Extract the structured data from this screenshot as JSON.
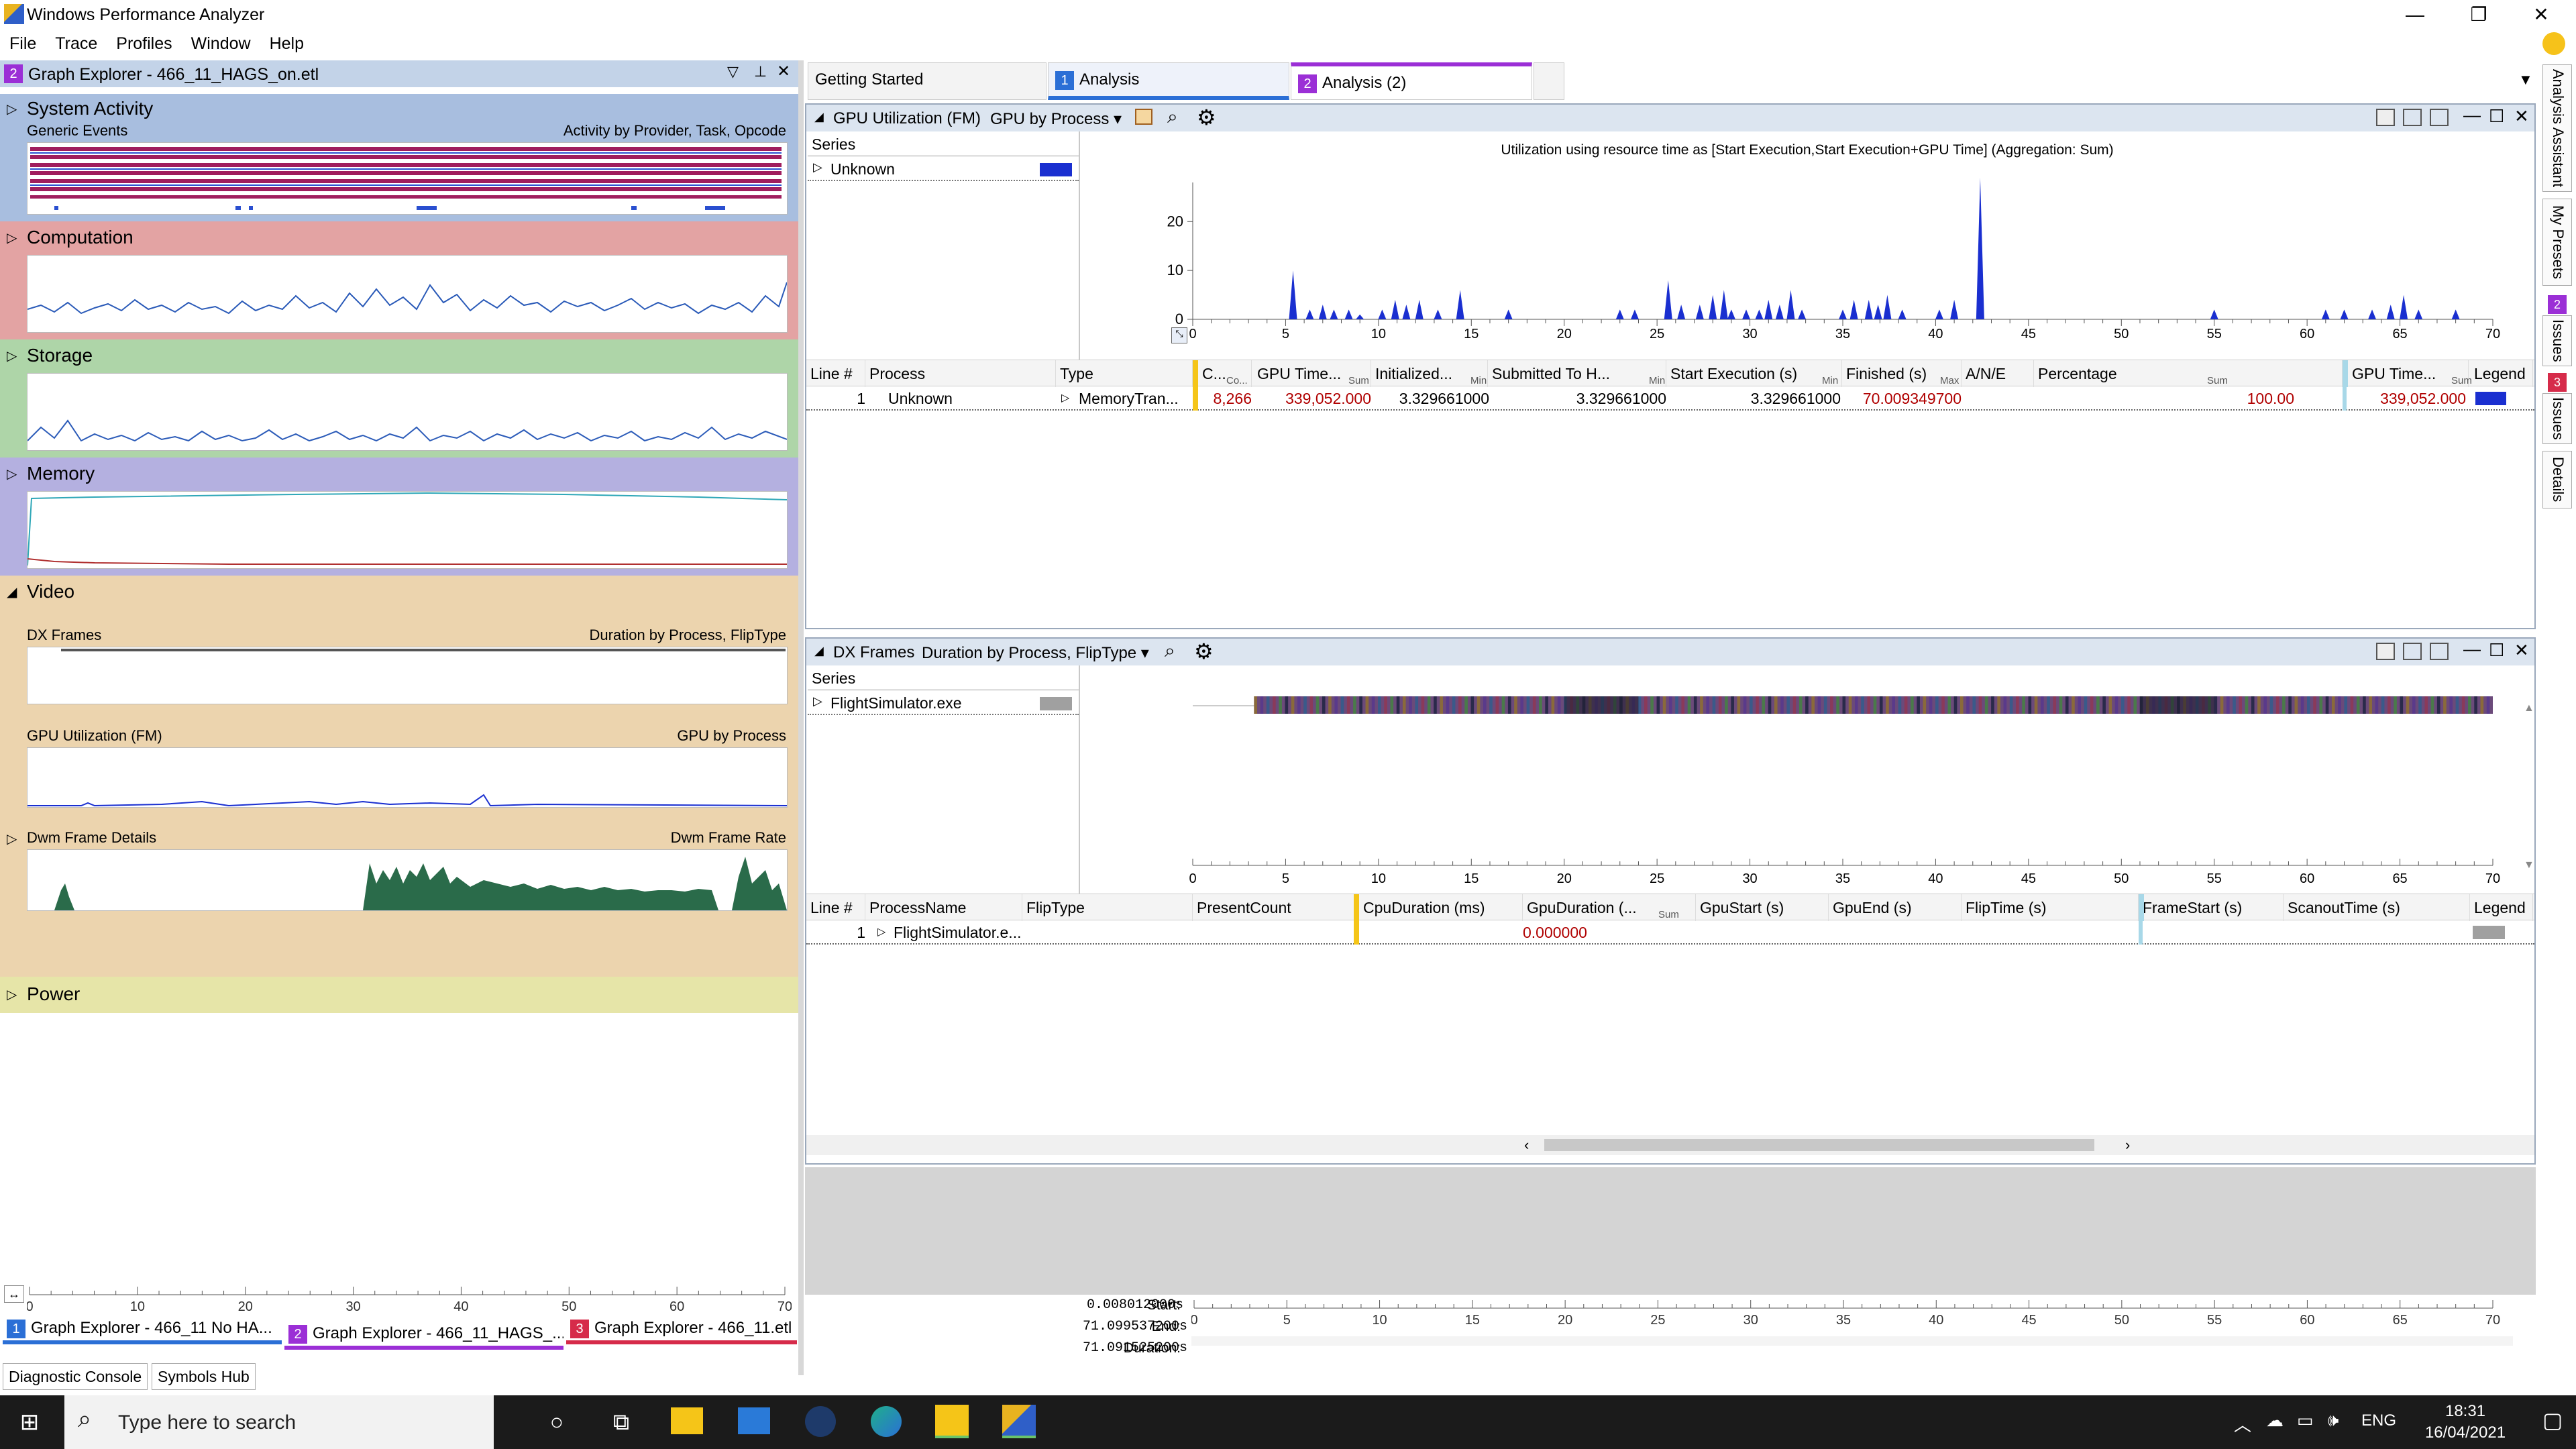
{
  "app": {
    "title": "Windows Performance Analyzer"
  },
  "window_controls": {
    "minimize": "—",
    "restore": "❐",
    "close": "✕"
  },
  "menu": [
    "File",
    "Trace",
    "Profiles",
    "Window",
    "Help"
  ],
  "graph_explorer": {
    "tab_num": "2",
    "title": "Graph Explorer - 466_11_HAGS_on.etl",
    "groups": [
      {
        "name": "System Activity",
        "sub": "Generic Events",
        "right": "Activity by Provider, Task, Opcode",
        "color": "#a8bedf"
      },
      {
        "name": "Computation",
        "color": "#e3a3a3"
      },
      {
        "name": "Storage",
        "color": "#aed5a8"
      },
      {
        "name": "Memory",
        "color": "#b4b0e0"
      },
      {
        "name": "Video",
        "color": "#ecd4ae"
      },
      {
        "name": "Power",
        "color": "#e6e5a8"
      }
    ],
    "video": {
      "dx_frames": "DX Frames",
      "dx_right": "Duration by Process, FlipType",
      "gpu_util": "GPU Utilization (FM)",
      "gpu_right": "GPU by Process",
      "dwm": "Dwm Frame Details",
      "dwm_right": "Dwm Frame Rate"
    },
    "axis_ticks": [
      "0",
      "10",
      "20",
      "30",
      "40",
      "50",
      "60",
      "70"
    ]
  },
  "doc_tabs": [
    {
      "label": "Getting Started",
      "num": "",
      "color": ""
    },
    {
      "label": "Analysis",
      "num": "1",
      "color": "#2b6fd6"
    },
    {
      "label": "Analysis (2)",
      "num": "2",
      "color": "#9b2fd6"
    }
  ],
  "gpu_panel": {
    "title": "GPU Utilization (FM)",
    "preset": "GPU by Process",
    "series_header": "Series",
    "series": [
      {
        "name": "Unknown",
        "color": "#1a2fd0"
      }
    ],
    "chart_title": "Utilization using resource time as [Start Execution,Start Execution+GPU Time] (Aggregation: Sum)",
    "y_ticks": [
      "0",
      "10",
      "20"
    ],
    "x_ticks": [
      "0",
      "5",
      "10",
      "15",
      "20",
      "25",
      "30",
      "35",
      "40",
      "45",
      "50",
      "55",
      "60",
      "65",
      "70"
    ],
    "columns": [
      "Line #",
      "Process",
      "Type",
      "C...",
      "GPU Time...",
      "Initialized...",
      "Submitted To H...",
      "Start Execution (s)",
      "Finished (s)",
      "A/N/E",
      "Percentage",
      "GPU Time...",
      "Legend"
    ],
    "col_aggr": [
      "Co...",
      "Sum",
      "Min",
      "Min",
      "Min",
      "Max",
      "Sum",
      "Sum"
    ],
    "row": {
      "line": "1",
      "process": "Unknown",
      "type": "MemoryTran...",
      "count": "8,266",
      "gpu_time": "339,052.000",
      "initialized": "3.329661000",
      "submitted": "3.329661000",
      "start_exec": "3.329661000",
      "finished": "70.009349700",
      "percentage": "100.00",
      "gpu_time2": "339,052.000"
    }
  },
  "dx_panel": {
    "title": "DX Frames",
    "preset": "Duration by Process, FlipType",
    "series_header": "Series",
    "series": [
      {
        "name": "FlightSimulator.exe",
        "color": "#a0a0a0"
      }
    ],
    "x_ticks": [
      "0",
      "5",
      "10",
      "15",
      "20",
      "25",
      "30",
      "35",
      "40",
      "45",
      "50",
      "55",
      "60",
      "65",
      "70"
    ],
    "columns": [
      "Line #",
      "ProcessName",
      "FlipType",
      "PresentCount",
      "CpuDuration (ms)",
      "GpuDuration (...",
      "GpuStart (s)",
      "GpuEnd (s)",
      "FlipTime (s)",
      "FrameStart (s)",
      "ScanoutTime (s)",
      "Legend"
    ],
    "col_aggr": [
      "Sum"
    ],
    "row": {
      "line": "1",
      "process": "FlightSimulator.e...",
      "gpu_duration": "0.000000"
    }
  },
  "time_info": {
    "start_label": "Start:",
    "start": "0.008012000s",
    "end_label": "End:",
    "end": "71.099537200s",
    "duration_label": "Duration:",
    "duration": "71.091525200s"
  },
  "bottom_tabs": [
    {
      "num": "1",
      "label": "Graph Explorer - 466_11 No HA...",
      "color": "#2b6fd6"
    },
    {
      "num": "2",
      "label": "Graph Explorer - 466_11_HAGS_...",
      "color": "#9b2fd6"
    },
    {
      "num": "3",
      "label": "Graph Explorer - 466_11.etl",
      "color": "#d62b4a"
    }
  ],
  "bottom_buttons": [
    "Diagnostic Console",
    "Symbols Hub"
  ],
  "side_tabs": [
    "Analysis Assistant",
    "My Presets",
    "Issues",
    "Issues",
    "Details"
  ],
  "side_badges": [
    "2",
    "3"
  ],
  "taskbar": {
    "search_placeholder": "Type here to search",
    "lang": "ENG",
    "time": "18:31",
    "date": "16/04/2021"
  }
}
